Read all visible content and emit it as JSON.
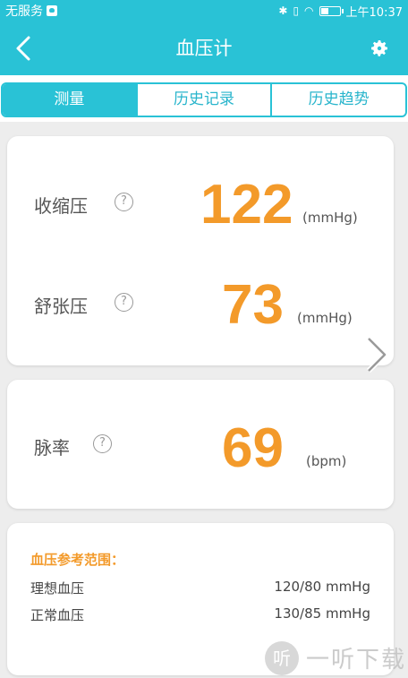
{
  "status_bar": {
    "carrier": "无服务",
    "time": "上午10:37",
    "icons": [
      "bluetooth-icon",
      "vibrate-icon",
      "wifi-icon",
      "sim-icon",
      "battery-icon"
    ]
  },
  "navbar": {
    "title": "血压计",
    "back_icon": "back-arrow-icon",
    "settings_icon": "gear-icon"
  },
  "tabs": [
    {
      "label": "测量",
      "active": true
    },
    {
      "label": "历史记录",
      "active": false
    },
    {
      "label": "历史趋势",
      "active": false
    }
  ],
  "readings": {
    "systolic": {
      "label": "收缩压",
      "help": "?",
      "value": "122",
      "unit": "(mmHg)"
    },
    "diastolic": {
      "label": "舒张压",
      "help": "?",
      "value": "73",
      "unit": "(mmHg)"
    },
    "pulse": {
      "label": "脉率",
      "help": "?",
      "value": "69",
      "unit": "(bpm)"
    }
  },
  "reference": {
    "heading": "血压参考范围：",
    "items": [
      {
        "label": "理想血压",
        "value": "120/80 mmHg"
      },
      {
        "label": "正常血压",
        "value": "130/85 mmHg"
      }
    ]
  },
  "watermark": {
    "logo": "听",
    "text": "一听下载"
  },
  "colors": {
    "accent": "#29c2d6",
    "value": "#f39a2a",
    "background": "#ededed"
  }
}
